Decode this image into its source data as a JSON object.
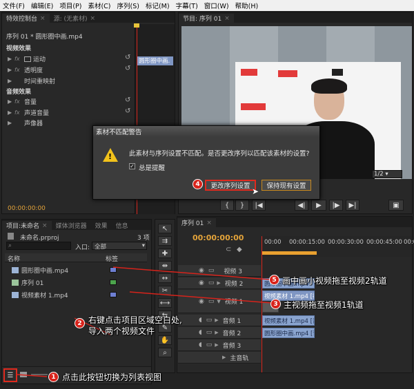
{
  "menu": [
    "文件(F)",
    "编辑(E)",
    "项目(P)",
    "素材(C)",
    "序列(S)",
    "标记(M)",
    "字幕(T)",
    "窗口(W)",
    "帮助(H)"
  ],
  "effect_controls": {
    "tabs": [
      "特效控制台",
      "源: (无素材)"
    ],
    "sequence_label": "序列 01 * 圆形圈中画.mp4",
    "clip_name": "圆形圈中画.",
    "sections": {
      "video": "视频效果",
      "motion": "运动",
      "opacity": "透明度",
      "time_remap": "时间重映射",
      "audio": "音频效果",
      "volume": "音量",
      "channel_volume": "声道音量",
      "panner": "声像器"
    },
    "timecode": "00:00:00:00"
  },
  "program_monitor": {
    "tab": "节目: 序列 01",
    "zoom": "1/2"
  },
  "dialog": {
    "title": "素材不匹配警告",
    "message": "此素材与序列设置不匹配。是否更改序列以匹配该素材的设置?",
    "checkbox_label": "总是提醒",
    "change_button": "更改序列设置",
    "keep_button": "保持现有设置"
  },
  "project": {
    "tabs": [
      "项目:未命名",
      "媒体浏览器",
      "效果",
      "信息"
    ],
    "project_name": "未命名.prproj",
    "item_count": "3 项",
    "entry_label": "入口:",
    "entry_value": "全部",
    "col_name": "名称",
    "col_label": "标签",
    "items": [
      {
        "name": "圆形圈中画.mp4",
        "color": "#6e7fd2"
      },
      {
        "name": "序列 01",
        "color": "#4ca44c"
      },
      {
        "name": "视频素材 1.mp4",
        "color": "#6e7fd2"
      }
    ]
  },
  "timeline": {
    "tab": "序列 01",
    "timecode": "00:00:00:00",
    "ruler": [
      "00:00",
      "00:00:15:00",
      "00:00:30:00",
      "00:00:45:00",
      "00:0"
    ],
    "tracks": {
      "v3": "视频 3",
      "v2": "视频 2",
      "v1": "视频 1",
      "a1": "音频 1",
      "a2": "音频 2",
      "a3": "音频 3",
      "master": "主音轨"
    },
    "clips": {
      "v2": "圆形圈中画.mp4",
      "v1": "视频素材 1.mp4 [视",
      "a1": "视频素材 1.mp4 [音",
      "a2": "圆形圈中画.mp4 [音"
    }
  },
  "annotations": {
    "a1": {
      "num": "1",
      "text": "点击此按钮切换为列表视图"
    },
    "a2": {
      "num": "2",
      "line1": "右键点击项目区域空白处,",
      "line2": "导入两个视频文件"
    },
    "a3": {
      "num": "3",
      "text": "主视频拖至视频1轨道"
    },
    "a4": {
      "num": "4"
    },
    "a5": {
      "num": "5",
      "text": "画中画小视频拖至视频2轨道"
    }
  },
  "colors": {
    "annotation_red": "#d8231b",
    "clip_blue": "#8aa4cf",
    "playhead": "#d9261c"
  }
}
